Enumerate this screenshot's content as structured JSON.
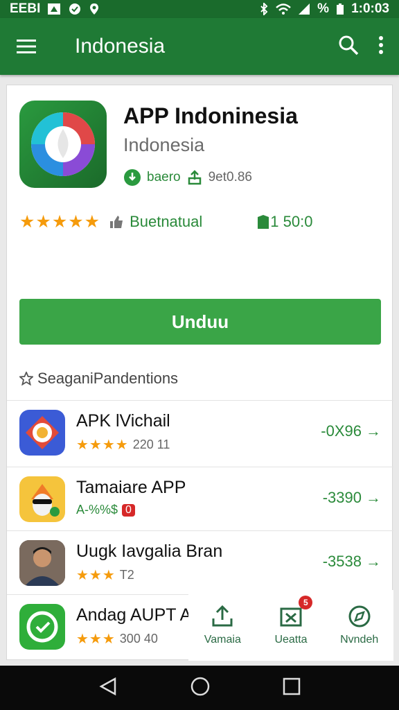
{
  "status_bar": {
    "left_text": "EEBI",
    "right_text": "%",
    "time": "1:0:03"
  },
  "app_bar": {
    "title": "Indonesia",
    "menu_icon": "menu-icon",
    "search_icon": "search-icon",
    "overflow_icon": "more-vert-icon"
  },
  "app": {
    "name": "APP Indoninesia",
    "developer": "Indonesia",
    "meta_label": "baero",
    "meta_size": "9et0.86",
    "rating_stars": "★★★★★",
    "rating_label": "Buetnatual",
    "downloads": "1 50:0",
    "install_label": "Unduu"
  },
  "section": {
    "title": "SeaganiPandentions"
  },
  "list": [
    {
      "name": "APK lVichail",
      "stars": "★★★★",
      "sub": "220 11",
      "pct": "-0X96"
    },
    {
      "name": "Tamaiare APP",
      "stars": "",
      "sub": "A-%%$",
      "badge_text": "0",
      "pct": "-3390"
    },
    {
      "name": "Uugk Iavgalia Bran",
      "stars": "★★★",
      "sub": "T2",
      "pct": "-3538"
    },
    {
      "name": "Andag AUPT A",
      "stars": "★★★",
      "sub": "300 40",
      "pct": ""
    }
  ],
  "floating_bar": [
    {
      "label": "Vamaia",
      "icon": "upload-icon"
    },
    {
      "label": "Ueatta",
      "icon": "download-box-icon",
      "badge": "5"
    },
    {
      "label": "Nvndeh",
      "icon": "compass-icon"
    }
  ],
  "colors": {
    "primary": "#1f7a35",
    "status": "#1a6b2c",
    "accent": "#3aa547",
    "star": "#f59b0c"
  }
}
